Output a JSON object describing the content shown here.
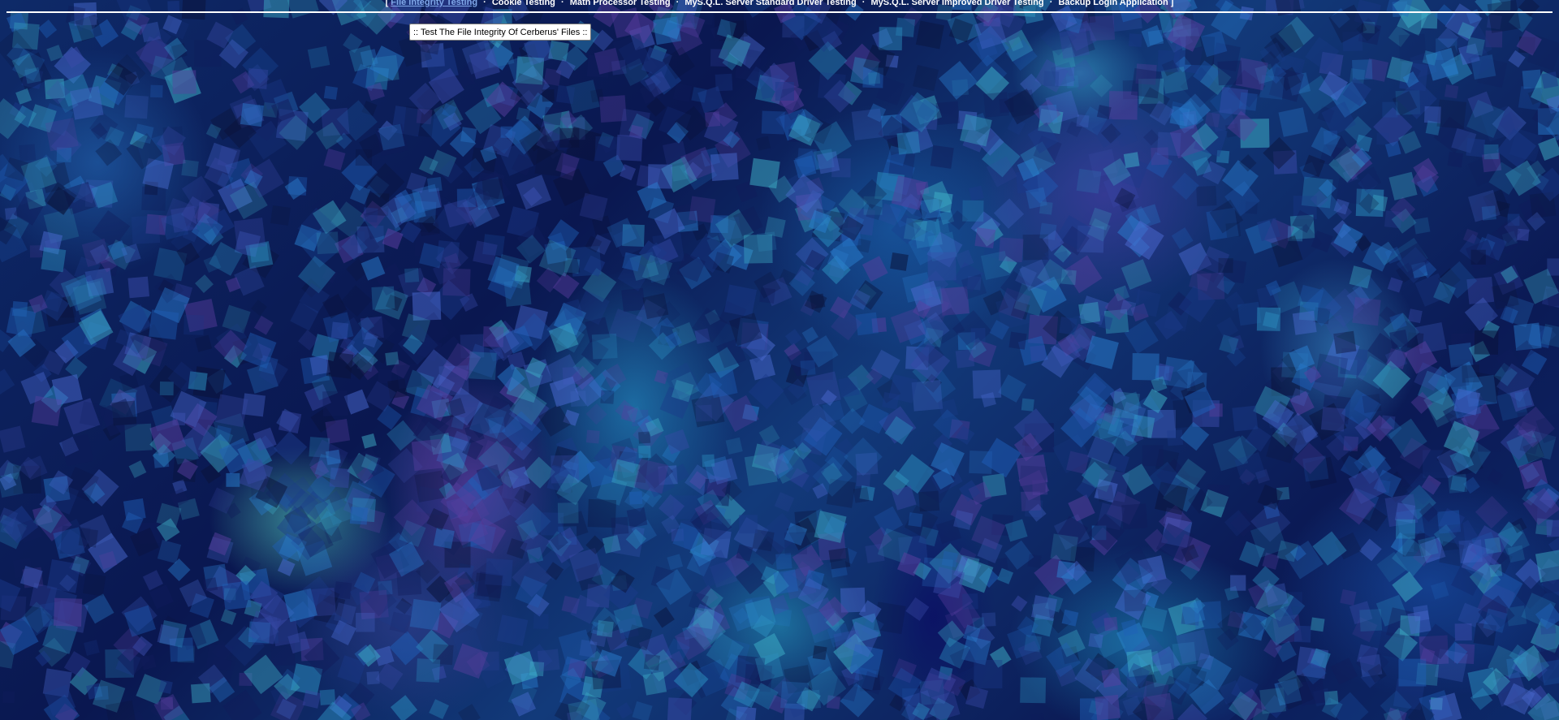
{
  "nav": {
    "open_bracket": "[",
    "close_bracket": "]",
    "separator": "·",
    "items": [
      {
        "label": "File Integrity Testing",
        "active": true
      },
      {
        "label": "Cookie Testing",
        "active": false
      },
      {
        "label": "Math Processor Testing",
        "active": false
      },
      {
        "label": "MyS.Q.L. Server Standard Driver Testing",
        "active": false
      },
      {
        "label": "MyS.Q.L. Server Improved Driver Testing",
        "active": false
      },
      {
        "label": "Backup Login Application",
        "active": false
      }
    ]
  },
  "main": {
    "test_button_label": ":: Test The File Integrity Of Cerberus' Files ::"
  },
  "colors": {
    "active_link": "#7fa7e8",
    "nav_text": "#ffffff",
    "background": "#0c1d52"
  }
}
